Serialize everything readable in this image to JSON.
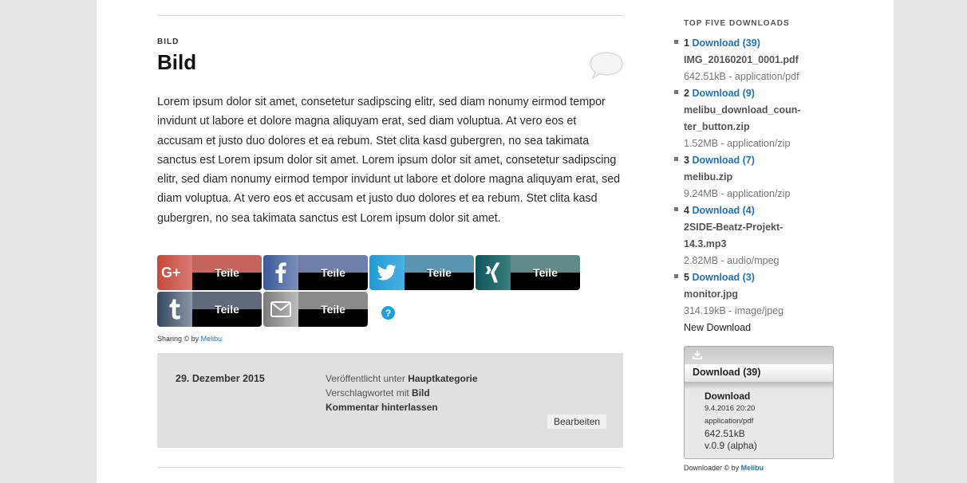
{
  "article": {
    "category": "BILD",
    "title": "Bild",
    "body": "Lorem ipsum dolor sit amet, consetetur sadipscing elitr, sed diam nonumy eirmod tempor invidunt ut labore et dolore magna aliquyam erat, sed diam voluptua. At vero eos et accusam et justo duo dolores et ea rebum. Stet clita kasd gubergren, no sea takimata sanctus est Lorem ipsum dolor sit amet. Lorem ipsum dolor sit amet, consetetur sadipscing elitr, sed diam nonumy eirmod tempor invidunt ut labore et dolore magna aliquyam erat, sed diam voluptua. At vero eos et accusam et justo duo dolores et ea rebum. Stet clita kasd gubergren, no sea takimata sanctus est Lorem ipsum dolor sit amet."
  },
  "share": {
    "buttons": [
      {
        "network": "google-plus",
        "label": "Teile",
        "color": "#c8473a"
      },
      {
        "network": "facebook",
        "label": "Teile",
        "color": "#3b5998"
      },
      {
        "network": "twitter",
        "label": "Teile",
        "color": "#2aa0d9"
      },
      {
        "network": "xing",
        "label": "Teile",
        "color": "#1a5f60"
      },
      {
        "network": "tumblr",
        "label": "Teile",
        "color": "#35465d"
      },
      {
        "network": "email",
        "label": "Teile",
        "color": "#7d7d7d"
      }
    ],
    "help": "?",
    "credit_prefix": "Sharing © by ",
    "credit_link": "Melibu"
  },
  "meta": {
    "date": "29. Dezember 2015",
    "published_prefix": "Veröffentlicht unter ",
    "published_category": "Hauptkategorie",
    "tagged_prefix": "Verschlagwortet mit ",
    "tagged_tag": "Bild",
    "comment": "Kommentar hinterlassen",
    "edit": "Bearbeiten"
  },
  "sidebar": {
    "heading": "TOP FIVE DOWNLOADS",
    "items": [
      {
        "rank": "1",
        "link": "Download (39)",
        "file": "IMG_20160201_0001.pdf",
        "info": "642.51kB - application/pdf"
      },
      {
        "rank": "2",
        "link": "Download (9)",
        "file": "melibu_download_coun-ter_button.zip",
        "info": "1.52MB - application/zip"
      },
      {
        "rank": "3",
        "link": "Download (7)",
        "file": "melibu.zip",
        "info": "9.24MB - application/zip"
      },
      {
        "rank": "4",
        "link": "Download (4)",
        "file": "2SIDE-Beatz-Projekt-14.3.mp3",
        "info": "2.82MB - audio/mpeg"
      },
      {
        "rank": "5",
        "link": "Download (3)",
        "file": "monitor.jpg",
        "info": "314.19kB - image/jpeg"
      }
    ],
    "new_download": "New Download",
    "widget": {
      "button_label": "Download (39)",
      "title": "Download",
      "date": "9.4.2016 20:20",
      "mime": "application/pdf",
      "size": "642.51kB",
      "version": "v.0.9 (alpha)"
    },
    "credit_prefix": "Downloader © by ",
    "credit_link": "Melibu"
  }
}
